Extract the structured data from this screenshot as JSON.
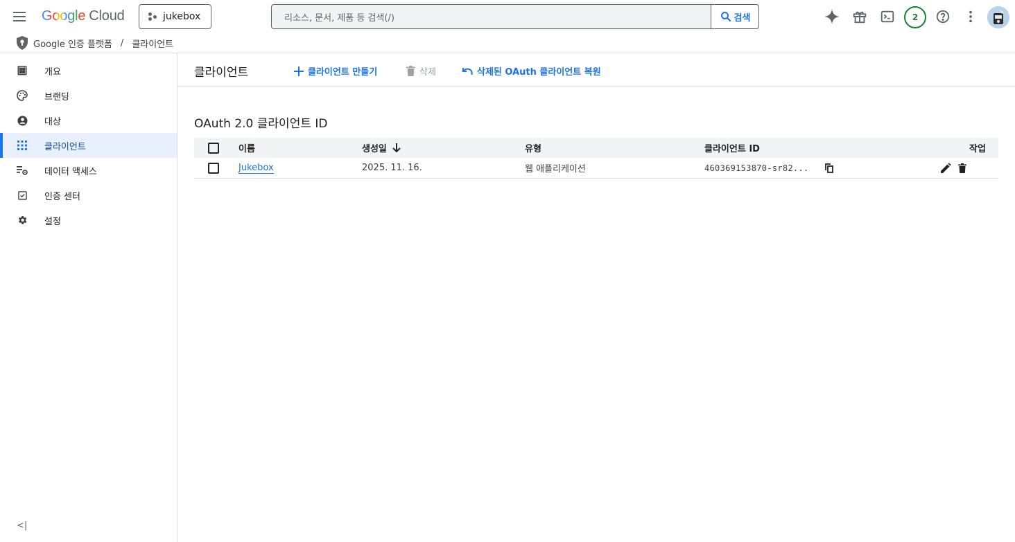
{
  "header": {
    "logo_google": "Google",
    "logo_cloud": "Cloud",
    "project": "jukebox",
    "search_placeholder": "리소스, 문서, 제품 등 검색(/)",
    "search_button": "검색",
    "notifications_count": "2"
  },
  "breadcrumb": {
    "product": "Google 인증 플랫폼",
    "separator": "/",
    "current": "클라이언트"
  },
  "sidebar": {
    "items": [
      {
        "label": "개요",
        "icon": "dashboard-icon"
      },
      {
        "label": "브랜딩",
        "icon": "palette-icon"
      },
      {
        "label": "대상",
        "icon": "account-circle-icon"
      },
      {
        "label": "클라이언트",
        "icon": "apps-grid-icon",
        "active": true
      },
      {
        "label": "데이터 액세스",
        "icon": "list-settings-icon"
      },
      {
        "label": "인증 센터",
        "icon": "verified-box-icon"
      },
      {
        "label": "설정",
        "icon": "gear-icon"
      }
    ],
    "collapse_label": "<|"
  },
  "toolbar": {
    "title": "클라이언트",
    "create_label": "클라이언트 만들기",
    "delete_label": "삭제",
    "restore_label": "삭제된 OAuth 클라이언트 복원"
  },
  "section": {
    "title": "OAuth 2.0 클라이언트 ID"
  },
  "table": {
    "headers": {
      "name": "이름",
      "created": "생성일",
      "type": "유형",
      "client_id": "클라이언트 ID",
      "actions": "작업"
    },
    "rows": [
      {
        "name": "Jukebox",
        "created": "2025. 11. 16.",
        "type": "웹 애플리케이션",
        "client_id": "460369153870-sr82..."
      }
    ]
  },
  "colors": {
    "accent": "#1a73e8",
    "active_bg": "#e8f0fe",
    "border": "#dadce0",
    "badge_green": "#188038"
  }
}
